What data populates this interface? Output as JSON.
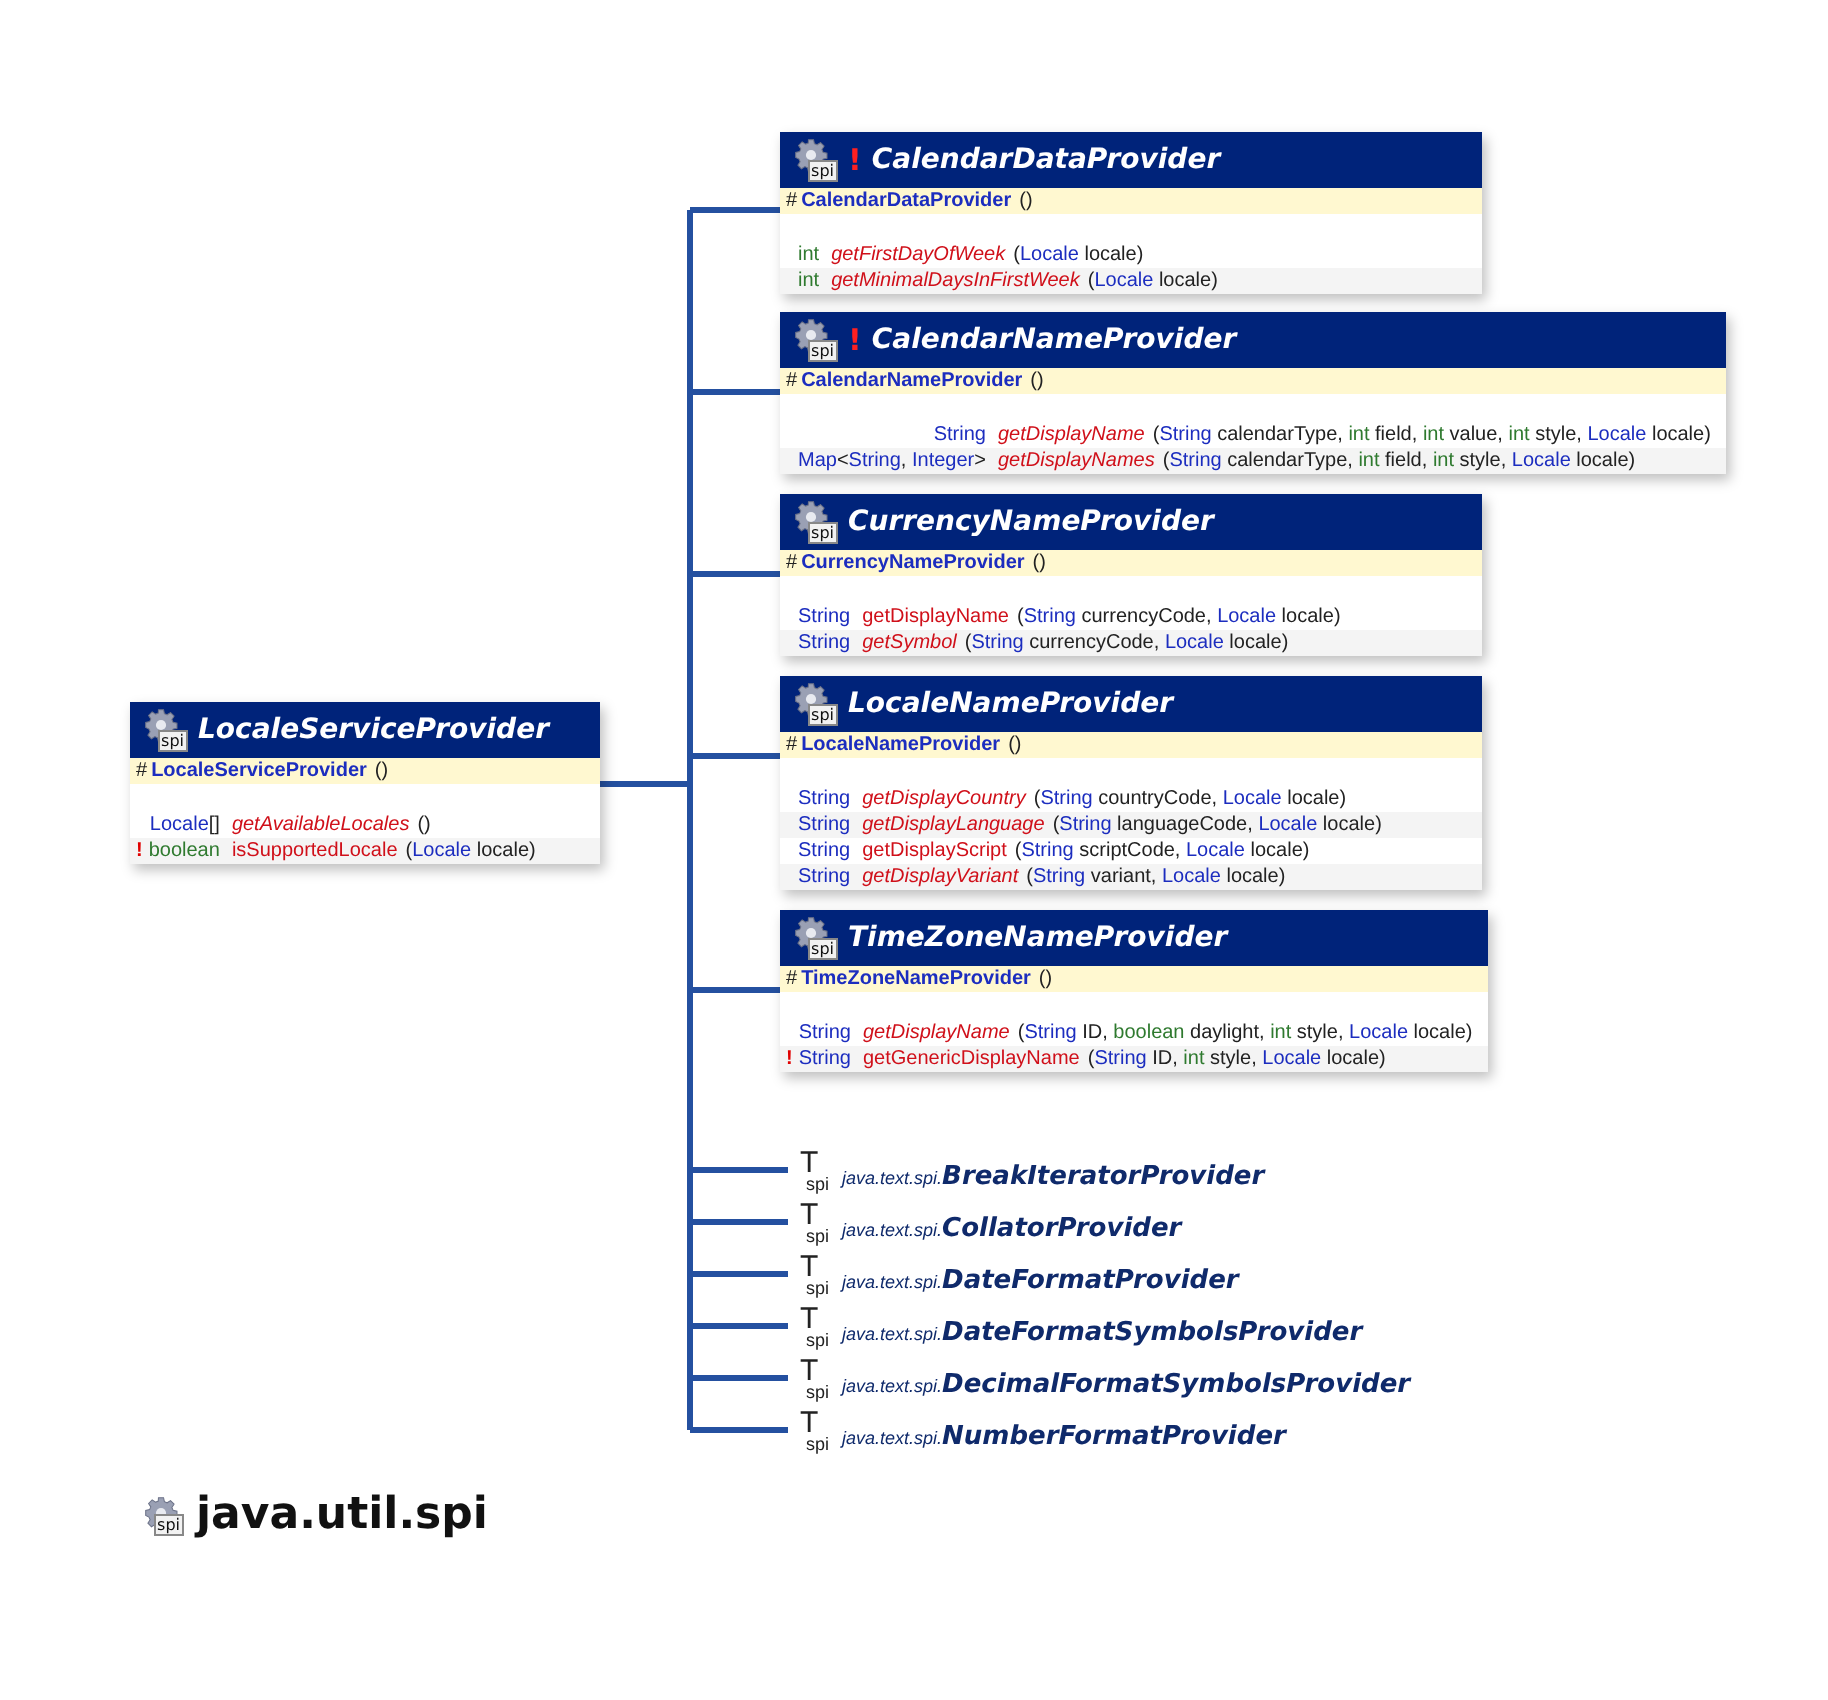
{
  "base_class": {
    "icon_label": "spi",
    "title": "LocaleServiceProvider",
    "constructor": {
      "modifier": "#",
      "name": "LocaleServiceProvider",
      "params": "()"
    },
    "methods": [
      {
        "returns": [
          {
            "text": "Locale",
            "kind": "type"
          },
          {
            "text": "[]",
            "kind": "plain"
          }
        ],
        "name": "getAvailableLocales",
        "abstract": true,
        "params": [
          {
            "text": "()",
            "kind": "plain"
          }
        ]
      },
      {
        "mark": "!",
        "returns": [
          {
            "text": "boolean",
            "kind": "primitive"
          }
        ],
        "name": "isSupportedLocale",
        "abstract": false,
        "params": [
          {
            "text": "(",
            "kind": "plain"
          },
          {
            "text": "Locale",
            "kind": "type"
          },
          {
            "text": " locale)",
            "kind": "plain"
          }
        ]
      }
    ]
  },
  "subclasses": [
    {
      "icon_label": "spi",
      "mark": "!",
      "title": "CalendarDataProvider",
      "constructor": {
        "modifier": "#",
        "name": "CalendarDataProvider",
        "params": "()"
      },
      "methods": [
        {
          "returns": [
            {
              "text": "int",
              "kind": "primitive"
            }
          ],
          "name": "getFirstDayOfWeek",
          "abstract": true,
          "params": [
            {
              "text": "(",
              "kind": "plain"
            },
            {
              "text": "Locale",
              "kind": "type"
            },
            {
              "text": " locale)",
              "kind": "plain"
            }
          ]
        },
        {
          "returns": [
            {
              "text": "int",
              "kind": "primitive"
            }
          ],
          "name": "getMinimalDaysInFirstWeek",
          "abstract": true,
          "params": [
            {
              "text": "(",
              "kind": "plain"
            },
            {
              "text": "Locale",
              "kind": "type"
            },
            {
              "text": " locale)",
              "kind": "plain"
            }
          ]
        }
      ]
    },
    {
      "icon_label": "spi",
      "mark": "!",
      "title": "CalendarNameProvider",
      "constructor": {
        "modifier": "#",
        "name": "CalendarNameProvider",
        "params": "()"
      },
      "methods": [
        {
          "returns": [
            {
              "text": "String",
              "kind": "type"
            }
          ],
          "name": "getDisplayName",
          "abstract": true,
          "params": [
            {
              "text": "(",
              "kind": "plain"
            },
            {
              "text": "String",
              "kind": "type"
            },
            {
              "text": " calendarType, ",
              "kind": "plain"
            },
            {
              "text": "int",
              "kind": "primitive"
            },
            {
              "text": " field, ",
              "kind": "plain"
            },
            {
              "text": "int",
              "kind": "primitive"
            },
            {
              "text": " value, ",
              "kind": "plain"
            },
            {
              "text": "int",
              "kind": "primitive"
            },
            {
              "text": " style, ",
              "kind": "plain"
            },
            {
              "text": "Locale",
              "kind": "type"
            },
            {
              "text": " locale)",
              "kind": "plain"
            }
          ]
        },
        {
          "returns": [
            {
              "text": "Map",
              "kind": "type"
            },
            {
              "text": "<",
              "kind": "plain"
            },
            {
              "text": "String",
              "kind": "type"
            },
            {
              "text": ", ",
              "kind": "plain"
            },
            {
              "text": "Integer",
              "kind": "type"
            },
            {
              "text": ">",
              "kind": "plain"
            }
          ],
          "name": "getDisplayNames",
          "abstract": true,
          "params": [
            {
              "text": "(",
              "kind": "plain"
            },
            {
              "text": "String",
              "kind": "type"
            },
            {
              "text": " calendarType, ",
              "kind": "plain"
            },
            {
              "text": "int",
              "kind": "primitive"
            },
            {
              "text": " field, ",
              "kind": "plain"
            },
            {
              "text": "int",
              "kind": "primitive"
            },
            {
              "text": " style, ",
              "kind": "plain"
            },
            {
              "text": "Locale",
              "kind": "type"
            },
            {
              "text": " locale)",
              "kind": "plain"
            }
          ]
        }
      ]
    },
    {
      "icon_label": "spi",
      "title": "CurrencyNameProvider",
      "constructor": {
        "modifier": "#",
        "name": "CurrencyNameProvider",
        "params": "()"
      },
      "methods": [
        {
          "returns": [
            {
              "text": "String",
              "kind": "type"
            }
          ],
          "name": "getDisplayName",
          "abstract": false,
          "params": [
            {
              "text": "(",
              "kind": "plain"
            },
            {
              "text": "String",
              "kind": "type"
            },
            {
              "text": " currencyCode, ",
              "kind": "plain"
            },
            {
              "text": "Locale",
              "kind": "type"
            },
            {
              "text": " locale)",
              "kind": "plain"
            }
          ]
        },
        {
          "returns": [
            {
              "text": "String",
              "kind": "type"
            }
          ],
          "name": "getSymbol",
          "abstract": true,
          "params": [
            {
              "text": "(",
              "kind": "plain"
            },
            {
              "text": "String",
              "kind": "type"
            },
            {
              "text": " currencyCode, ",
              "kind": "plain"
            },
            {
              "text": "Locale",
              "kind": "type"
            },
            {
              "text": " locale)",
              "kind": "plain"
            }
          ]
        }
      ]
    },
    {
      "icon_label": "spi",
      "title": "LocaleNameProvider",
      "constructor": {
        "modifier": "#",
        "name": "LocaleNameProvider",
        "params": "()"
      },
      "methods": [
        {
          "returns": [
            {
              "text": "String",
              "kind": "type"
            }
          ],
          "name": "getDisplayCountry",
          "abstract": true,
          "params": [
            {
              "text": "(",
              "kind": "plain"
            },
            {
              "text": "String",
              "kind": "type"
            },
            {
              "text": " countryCode, ",
              "kind": "plain"
            },
            {
              "text": "Locale",
              "kind": "type"
            },
            {
              "text": " locale)",
              "kind": "plain"
            }
          ]
        },
        {
          "returns": [
            {
              "text": "String",
              "kind": "type"
            }
          ],
          "name": "getDisplayLanguage",
          "abstract": true,
          "params": [
            {
              "text": "(",
              "kind": "plain"
            },
            {
              "text": "String",
              "kind": "type"
            },
            {
              "text": " languageCode, ",
              "kind": "plain"
            },
            {
              "text": "Locale",
              "kind": "type"
            },
            {
              "text": " locale)",
              "kind": "plain"
            }
          ]
        },
        {
          "returns": [
            {
              "text": "String",
              "kind": "type"
            }
          ],
          "name": "getDisplayScript",
          "abstract": false,
          "params": [
            {
              "text": "(",
              "kind": "plain"
            },
            {
              "text": "String",
              "kind": "type"
            },
            {
              "text": " scriptCode, ",
              "kind": "plain"
            },
            {
              "text": "Locale",
              "kind": "type"
            },
            {
              "text": " locale)",
              "kind": "plain"
            }
          ]
        },
        {
          "returns": [
            {
              "text": "String",
              "kind": "type"
            }
          ],
          "name": "getDisplayVariant",
          "abstract": true,
          "params": [
            {
              "text": "(",
              "kind": "plain"
            },
            {
              "text": "String",
              "kind": "type"
            },
            {
              "text": " variant, ",
              "kind": "plain"
            },
            {
              "text": "Locale",
              "kind": "type"
            },
            {
              "text": " locale)",
              "kind": "plain"
            }
          ]
        }
      ]
    },
    {
      "icon_label": "spi",
      "title": "TimeZoneNameProvider",
      "constructor": {
        "modifier": "#",
        "name": "TimeZoneNameProvider",
        "params": "()"
      },
      "methods": [
        {
          "returns": [
            {
              "text": "String",
              "kind": "type"
            }
          ],
          "name": "getDisplayName",
          "abstract": true,
          "params": [
            {
              "text": "(",
              "kind": "plain"
            },
            {
              "text": "String",
              "kind": "type"
            },
            {
              "text": " ID, ",
              "kind": "plain"
            },
            {
              "text": "boolean",
              "kind": "primitive"
            },
            {
              "text": " daylight, ",
              "kind": "plain"
            },
            {
              "text": "int",
              "kind": "primitive"
            },
            {
              "text": " style, ",
              "kind": "plain"
            },
            {
              "text": "Locale",
              "kind": "type"
            },
            {
              "text": " locale)",
              "kind": "plain"
            }
          ]
        },
        {
          "mark": "!",
          "returns": [
            {
              "text": "String",
              "kind": "type"
            }
          ],
          "name": "getGenericDisplayName",
          "abstract": false,
          "params": [
            {
              "text": "(",
              "kind": "plain"
            },
            {
              "text": "String",
              "kind": "type"
            },
            {
              "text": " ID, ",
              "kind": "plain"
            },
            {
              "text": "int",
              "kind": "primitive"
            },
            {
              "text": " style, ",
              "kind": "plain"
            },
            {
              "text": "Locale",
              "kind": "type"
            },
            {
              "text": " locale)",
              "kind": "plain"
            }
          ]
        }
      ]
    }
  ],
  "interfaces": [
    {
      "icon_letter": "T",
      "icon_label": "spi",
      "package": "java.text.spi.",
      "name": "BreakIteratorProvider"
    },
    {
      "icon_letter": "T",
      "icon_label": "spi",
      "package": "java.text.spi.",
      "name": "CollatorProvider"
    },
    {
      "icon_letter": "T",
      "icon_label": "spi",
      "package": "java.text.spi.",
      "name": "DateFormatProvider"
    },
    {
      "icon_letter": "T",
      "icon_label": "spi",
      "package": "java.text.spi.",
      "name": "DateFormatSymbolsProvider"
    },
    {
      "icon_letter": "T",
      "icon_label": "spi",
      "package": "java.text.spi.",
      "name": "DecimalFormatSymbolsProvider"
    },
    {
      "icon_letter": "T",
      "icon_label": "spi",
      "package": "java.text.spi.",
      "name": "NumberFormatProvider"
    }
  ],
  "package": {
    "icon_label": "spi",
    "name": "java.util.spi"
  }
}
